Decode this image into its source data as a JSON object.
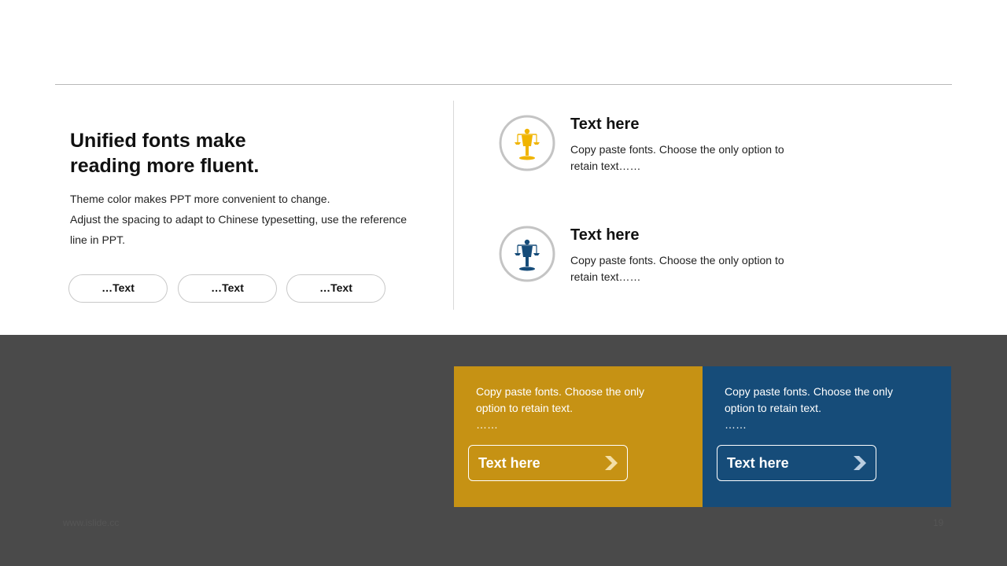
{
  "left": {
    "headline_line1": "Unified fonts make",
    "headline_line2": "reading more fluent.",
    "body_line1": "Theme color makes PPT more convenient  to change.",
    "body_line2": "Adjust the spacing to adapt to Chinese typesetting, use the reference line in PPT.",
    "pills": [
      "…Text",
      "…Text",
      "…Text"
    ]
  },
  "features": [
    {
      "title": "Text here",
      "desc": "Copy paste fonts. Choose the only option to retain text……",
      "icon": "justice-scales-icon",
      "color": "#f0b400"
    },
    {
      "title": "Text here",
      "desc": "Copy paste fonts. Choose the only option to retain text……",
      "icon": "justice-scales-icon",
      "color": "#164c79"
    }
  ],
  "cards": [
    {
      "text": "Copy paste fonts. Choose the only option to retain text.",
      "ellipsis": "……",
      "button": "Text here",
      "color": "#c69214",
      "icon": "chevron-right-icon"
    },
    {
      "text": "Copy paste fonts. Choose the only option to retain text.",
      "ellipsis": "……",
      "button": "Text here",
      "color": "#164c79",
      "icon": "chevron-right-icon"
    }
  ],
  "footer": {
    "url": "www.islide.cc",
    "page": "19"
  },
  "colors": {
    "gold": "#c69214",
    "blue": "#164c79",
    "dark_band": "#4a4a4a"
  }
}
